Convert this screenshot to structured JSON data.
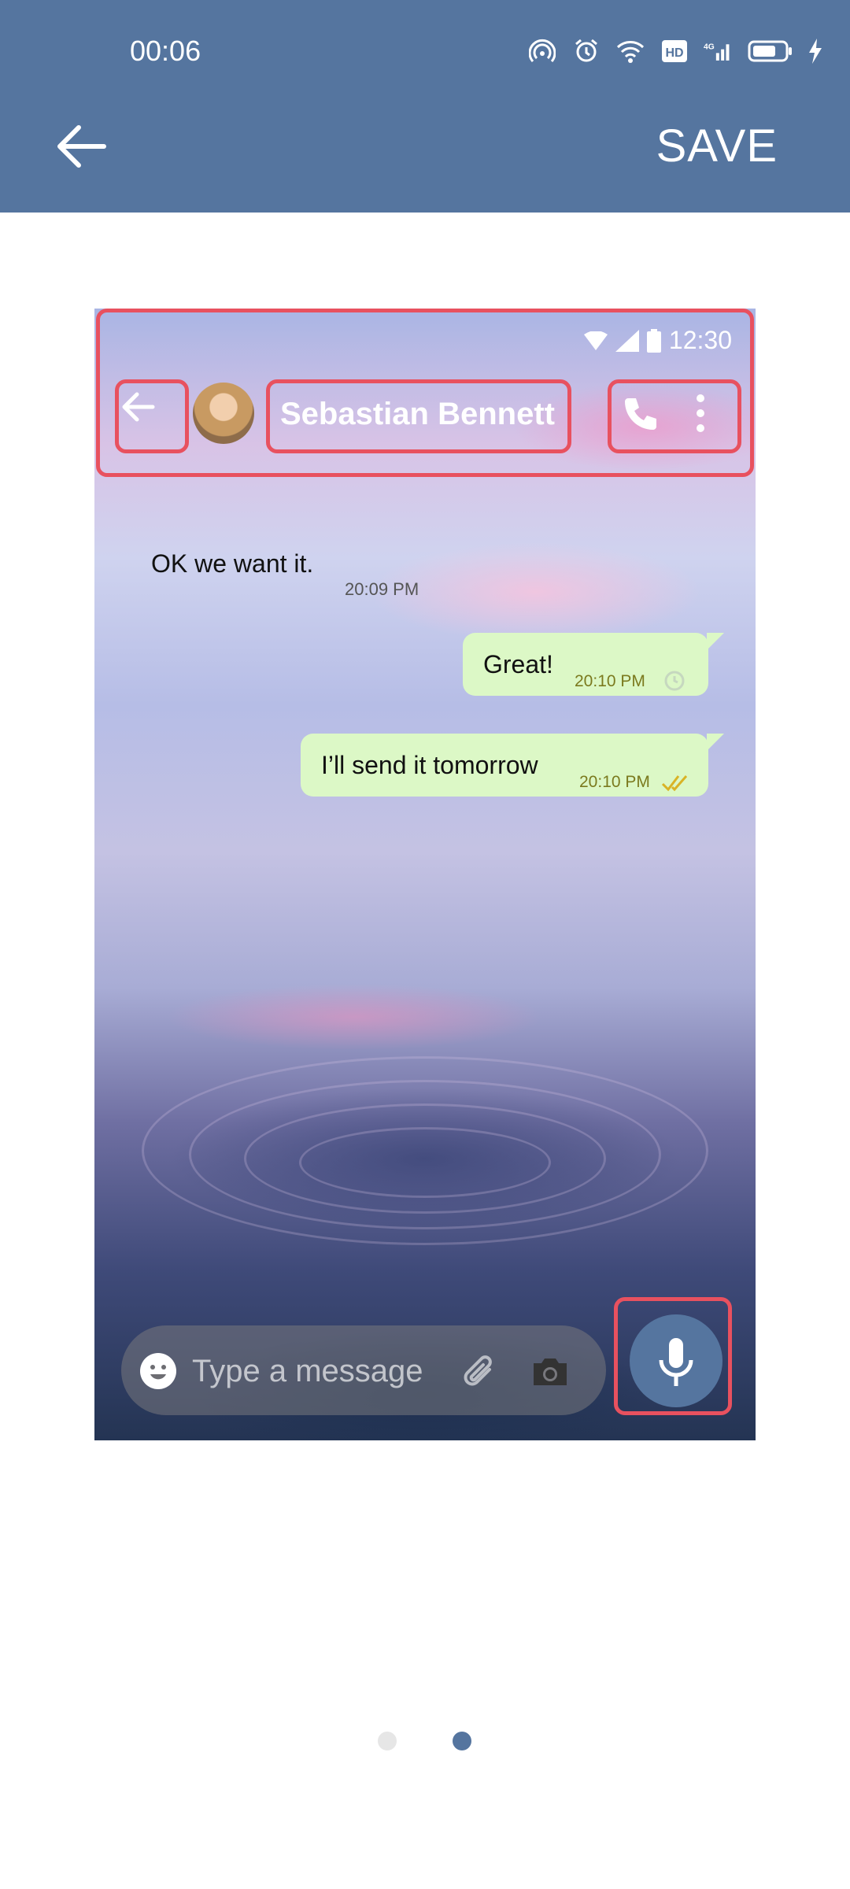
{
  "status_bar": {
    "time": "00:06",
    "icons": [
      "hotspot-icon",
      "alarm-icon",
      "wifi-icon",
      "hd-icon",
      "signal-4g-icon",
      "battery-icon",
      "charging-icon"
    ]
  },
  "toolbar": {
    "back_icon": "back-arrow-icon",
    "save_label": "SAVE"
  },
  "preview": {
    "status_time": "12:30",
    "contact_name": "Sebastian Bennett",
    "messages": [
      {
        "direction": "in",
        "text": "OK we want it.",
        "time": "20:09 PM"
      },
      {
        "direction": "out",
        "text": "Great!",
        "time": "20:10 PM",
        "status_icon": "clock-icon"
      },
      {
        "direction": "out",
        "text": "I’ll send it tomorrow",
        "time": "20:10 PM",
        "status_icon": "double-check-icon"
      }
    ],
    "input_placeholder": "Type a message",
    "colors": {
      "highlight": "#e8515f",
      "bubble_out": "#dcf8c6",
      "accent": "#55759f"
    }
  },
  "pager": {
    "page_count": 2,
    "active_index": 1
  }
}
